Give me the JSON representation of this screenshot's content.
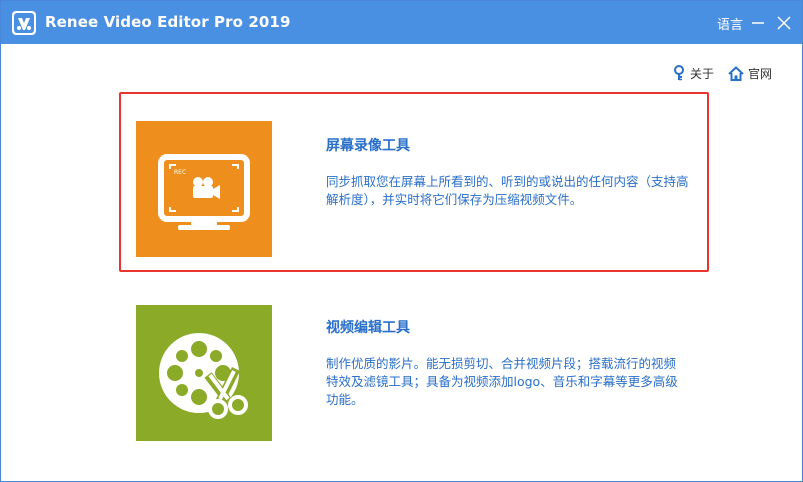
{
  "app": {
    "title": "Renee Video Editor Pro 2019",
    "language_label": "语言"
  },
  "toplinks": {
    "about": "关于",
    "website": "官网"
  },
  "tools": [
    {
      "title": "屏幕录像工具",
      "description": "同步抓取您在屏幕上所看到的、听到的或说出的任何内容（支持高解析度），并实时将它们保存为压缩视频文件。",
      "icon_label": "REC",
      "icon": "screen-recorder-icon",
      "tile_color": "#ee8f1d",
      "selected": true
    },
    {
      "title": "视频编辑工具",
      "description": "制作优质的影片。能无损剪切、合并视频片段；搭载流行的视频特效及滤镜工具；具备为视频添加logo、音乐和字幕等更多高级功能。",
      "icon": "film-reel-scissors-icon",
      "tile_color": "#8aaa28",
      "selected": false
    }
  ],
  "colors": {
    "titlebar": "#4a90e2",
    "link_text": "#2a6fc9",
    "selection_border": "#e8362f"
  }
}
